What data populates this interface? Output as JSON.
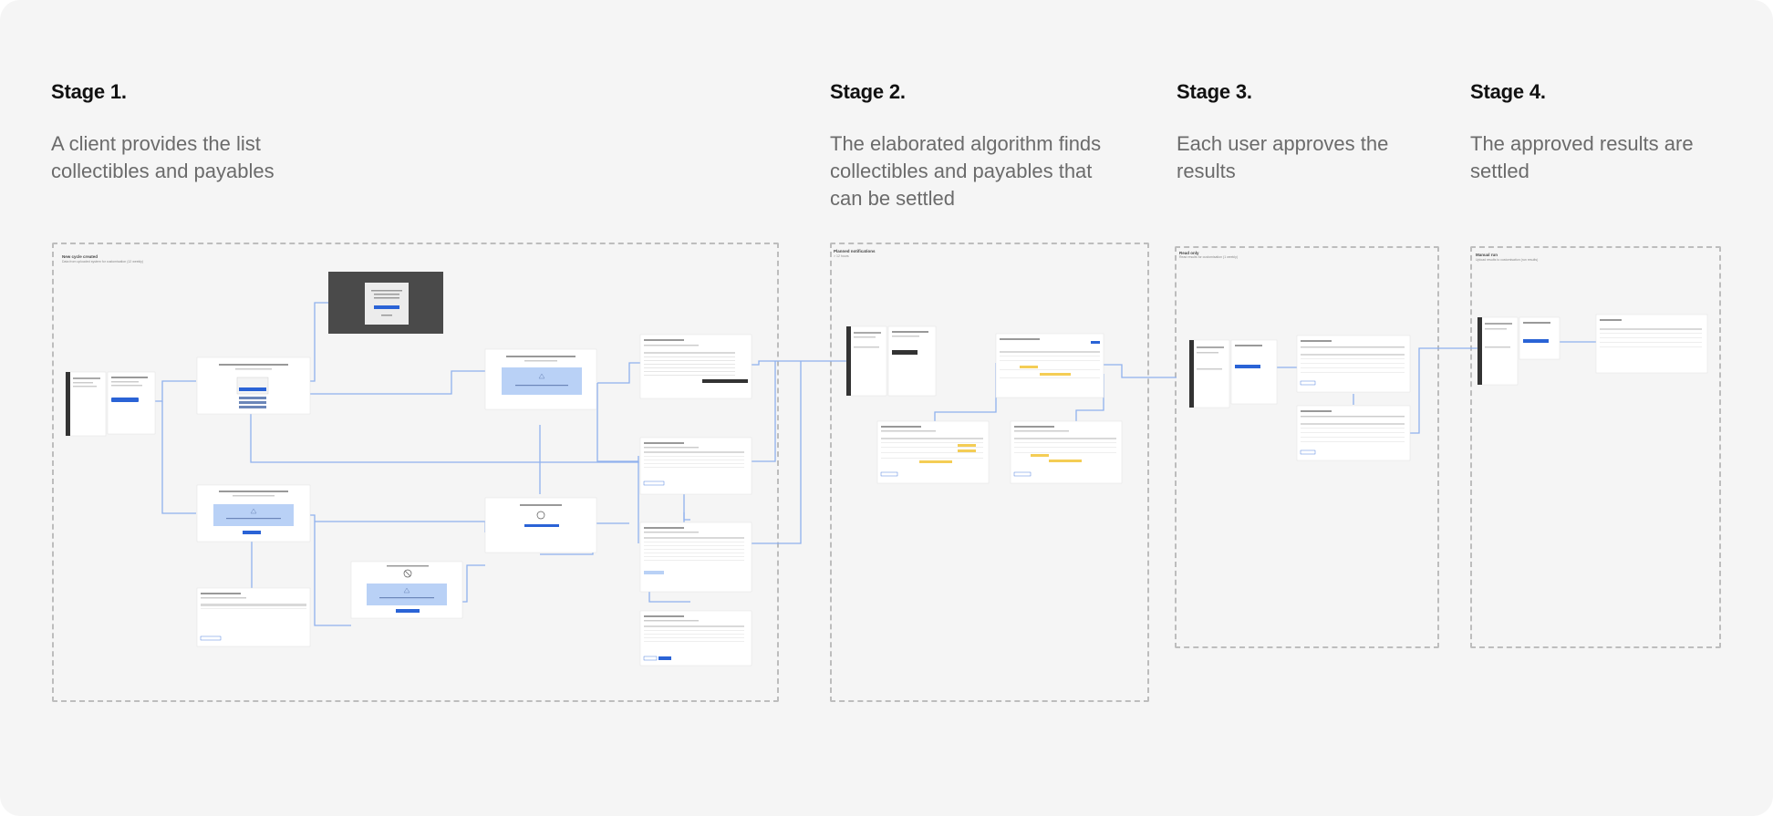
{
  "stages": [
    {
      "title": "Stage 1.",
      "description_lines": [
        "A client provides the list",
        "collectibles and payables"
      ]
    },
    {
      "title": "Stage 2.",
      "description_lines": [
        "The elaborated algorithm finds",
        "collectibles and payables that",
        "can be settled"
      ]
    },
    {
      "title": "Stage 3.",
      "description_lines": [
        "Each user approves the",
        "results"
      ]
    },
    {
      "title": "Stage 4.",
      "description_lines": [
        "The approved results are",
        "settled"
      ]
    }
  ],
  "frames": [
    {
      "label": "New cycle created",
      "sublabel": "Data from uploaded system for customisation (12 weekly)"
    },
    {
      "label": "Planned notifications",
      "sublabel": "> 12 hours"
    },
    {
      "label": "Read only",
      "sublabel": "Read results for customisation (1 weekly)"
    },
    {
      "label": "Manual run",
      "sublabel": "Upload results to customisation (run results)"
    }
  ],
  "colors": {
    "background": "#f5f5f5",
    "frame_border": "#bdbdbd",
    "connector": "#8fb1ee",
    "accent_blue": "#2a63d6",
    "info_block": "#b9d1f6",
    "highlight_yellow": "#f4cd55",
    "dark_panel": "#3a3a3a",
    "sidebar_dark": "#333333"
  }
}
